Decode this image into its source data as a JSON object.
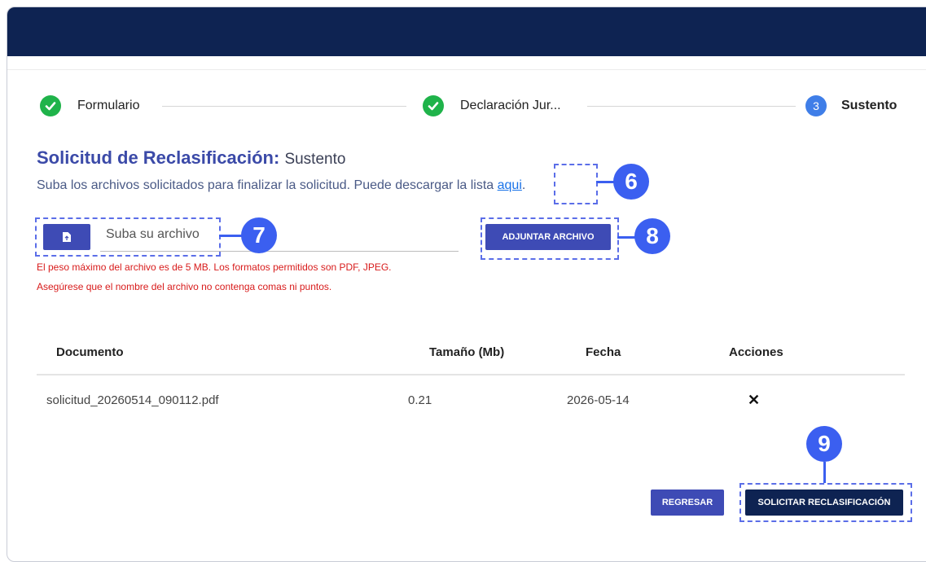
{
  "stepper": {
    "steps": [
      {
        "label": "Formulario",
        "state": "done"
      },
      {
        "label": "Declaración Jur...",
        "state": "done"
      },
      {
        "label": "Sustento",
        "state": "active",
        "number": "3"
      }
    ]
  },
  "page": {
    "title_bold": "Solicitud de Reclasificación:",
    "title_light": "Sustento",
    "subtitle_text": "Suba los archivos solicitados para finalizar la solicitud. Puede descargar la lista ",
    "subtitle_link": "aqui",
    "subtitle_end": "."
  },
  "upload": {
    "icon": "file-upload-icon",
    "placeholder": "Suba su archivo",
    "attach_label": "ADJUNTAR ARCHIVO"
  },
  "warnings": [
    "El peso máximo del archivo es de 5 MB. Los formatos permitidos son PDF, JPEG.",
    "Asegúrese que el nombre del archivo no contenga comas ni puntos."
  ],
  "table": {
    "headers": [
      "Documento",
      "Tamaño (Mb)",
      "Fecha",
      "Acciones"
    ],
    "rows": [
      {
        "documento": "solicitud_20260514_090112.pdf",
        "tamano": "0.21",
        "fecha": "2026-05-14",
        "accion": "✕"
      }
    ]
  },
  "actions": {
    "back_label": "REGRESAR",
    "submit_label": "SOLICITAR RECLASIFICACIÓN"
  },
  "annotations": {
    "n6": "6",
    "n7": "7",
    "n8": "8",
    "n9": "9"
  },
  "colors": {
    "navy": "#0e2352",
    "primary": "#3e4bb5",
    "success": "#1fb34a",
    "active_step": "#3f7ee8",
    "error": "#d81b1b",
    "annotation": "#3b5ff0"
  }
}
